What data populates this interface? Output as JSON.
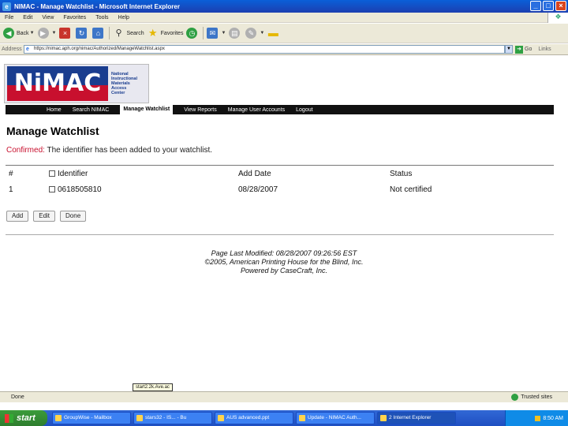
{
  "window": {
    "title": "NIMAC - Manage Watchlist - Microsoft Internet Explorer",
    "icon_letter": "e",
    "buttons": [
      "_",
      "□",
      "×"
    ]
  },
  "menubar": [
    "File",
    "Edit",
    "View",
    "Favorites",
    "Tools",
    "Help"
  ],
  "toolbar": {
    "back": "Back",
    "search": "Search",
    "favorites": "Favorites"
  },
  "addressbar": {
    "label": "Address",
    "url": "https://nimac.aph.org/nimac/Authorized/ManageWatchlist.aspx",
    "go": "Go",
    "links": "Links"
  },
  "logo": {
    "mark": "NiMAC",
    "text_lines": [
      "National",
      "Instructional",
      "Materials",
      "Access",
      "Center"
    ]
  },
  "nav": {
    "items": [
      "Home",
      "Search NIMAC",
      "Manage Watchlist",
      "View Reports",
      "Manage User Accounts",
      "Logout"
    ],
    "active": "Manage Watchlist"
  },
  "main": {
    "title": "Manage Watchlist",
    "confirm_label": "Confirmed:",
    "confirm_text": "The identifier has been added to your watchlist.",
    "table": {
      "headers": [
        "#",
        "Identifier",
        "Add Date",
        "Status"
      ],
      "rows": [
        {
          "num": "1",
          "identifier": "0618505810",
          "date": "08/28/2007",
          "status": "Not certified"
        }
      ]
    },
    "buttons": [
      "Add",
      "Edit",
      "Done"
    ]
  },
  "footer": {
    "line1": "Page Last Modified: 08/28/2007 09:26:56 EST",
    "line2": "©2005, American Printing House for the Blind, Inc.",
    "line3": "Powered by CaseCraft, Inc."
  },
  "statusbar": {
    "text": "Done",
    "zone": "Trusted sites",
    "tooltip": "start2.2k.Ave.ac"
  },
  "taskbar": {
    "start": "start",
    "tasks": [
      "GroupWise - Mailbox",
      "stars32 - IS... - Bu",
      "AUS advanced.ppt",
      "Update - NIMAC Auth...",
      "2 Internet Explorer"
    ],
    "active_task": 4,
    "clock": "8:50 AM"
  }
}
